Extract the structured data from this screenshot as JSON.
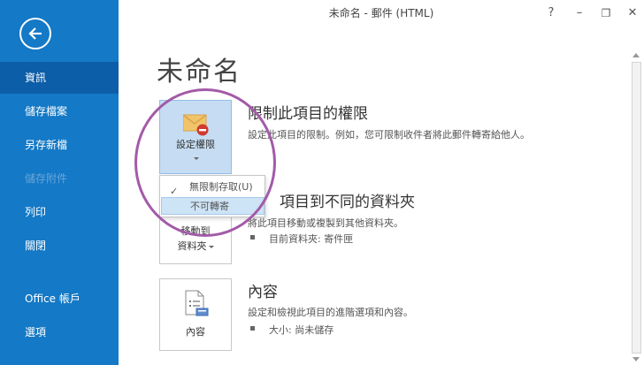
{
  "window": {
    "title": "未命名 - 郵件 (HTML)",
    "help_label": "?",
    "minimize_label": "–",
    "restore_label": "❐",
    "close_label": "✕"
  },
  "sidebar": {
    "items": [
      {
        "label": "資訊",
        "state": "active"
      },
      {
        "label": "儲存檔案",
        "state": "normal"
      },
      {
        "label": "另存新檔",
        "state": "normal"
      },
      {
        "label": "儲存附件",
        "state": "disabled"
      },
      {
        "label": "列印",
        "state": "normal"
      },
      {
        "label": "關閉",
        "state": "normal"
      },
      {
        "label": "Office 帳戶",
        "state": "normal"
      },
      {
        "label": "選項",
        "state": "normal"
      }
    ],
    "colors": {
      "background": "#1479c6",
      "active": "#0d5ea8"
    }
  },
  "main": {
    "heading": "未命名",
    "permissions": {
      "tile_label": "設定權限",
      "title": "限制此項目的權限",
      "description": "設定此項目的限制。例如，您可限制收件者將此郵件轉寄給他人。",
      "icon": "envelope-restrict-icon"
    },
    "dropdown": {
      "items": [
        {
          "label": "無限制存取(U)",
          "checked": true
        },
        {
          "label": "不可轉寄",
          "checked": false
        }
      ]
    },
    "move": {
      "tile_label_line1": "移動到",
      "tile_label_line2": "資料夾",
      "title": "項目到不同的資料夾",
      "description": "將此項目移動或複製到其他資料夾。",
      "detail": "目前資料夾:   寄件匣",
      "icon": "folder-move-icon"
    },
    "properties": {
      "tile_label": "內容",
      "title": "內容",
      "description": "設定和檢視此項目的進階選項和內容。",
      "detail": "大小:   尚未儲存",
      "icon": "document-properties-icon"
    }
  }
}
